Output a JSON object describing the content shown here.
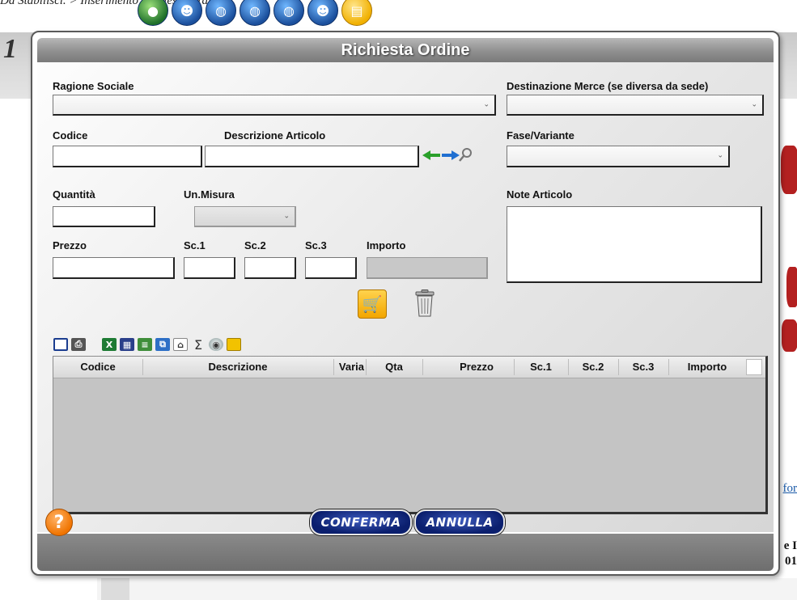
{
  "background": {
    "breadcrumb": "Da Stabilisci. > Inserimento Richieste Ordini",
    "page_number": "1",
    "right_link": "for",
    "right_text_1": "e I",
    "right_text_2": "01"
  },
  "modal": {
    "title": "Richiesta Ordine",
    "labels": {
      "ragione_sociale": "Ragione Sociale",
      "destinazione": "Destinazione Merce (se diversa da sede)",
      "codice": "Codice",
      "descrizione_articolo": "Descrizione Articolo",
      "fase_variante": "Fase/Variante",
      "quantita": "Quantità",
      "un_misura": "Un.Misura",
      "note_articolo": "Note Articolo",
      "prezzo": "Prezzo",
      "sc1": "Sc.1",
      "sc2": "Sc.2",
      "sc3": "Sc.3",
      "importo": "Importo"
    },
    "grid_columns": [
      "Codice",
      "Descrizione",
      "Varia",
      "Qta",
      "Prezzo",
      "Sc.1",
      "Sc.2",
      "Sc.3",
      "Importo"
    ],
    "footer": {
      "help": "?",
      "confirm": "CONFERMA",
      "cancel": "ANNULLA"
    },
    "toolbar_icons": [
      "window-icon",
      "print-icon",
      "excel-export-icon",
      "table-icon",
      "csv-export-icon",
      "copy-icon",
      "house-edit-icon",
      "sum-icon",
      "search-user-icon",
      "folder-icon"
    ]
  }
}
